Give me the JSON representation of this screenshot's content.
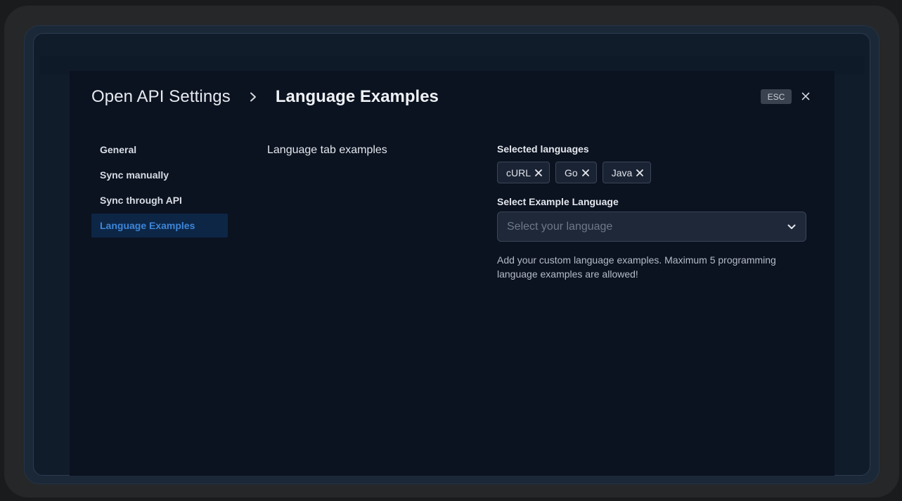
{
  "header": {
    "title": "Open API Settings",
    "subtitle": "Language Examples",
    "esc_label": "ESC"
  },
  "sidebar": {
    "items": [
      {
        "label": "General"
      },
      {
        "label": "Sync manually"
      },
      {
        "label": "Sync through API"
      },
      {
        "label": "Language Examples",
        "active": true
      }
    ]
  },
  "main": {
    "section_title": "Language tab examples",
    "selected_label": "Selected languages",
    "chips": [
      {
        "label": "cURL"
      },
      {
        "label": "Go"
      },
      {
        "label": "Java"
      }
    ],
    "select_label": "Select Example Language",
    "select_placeholder": "Select your language",
    "help_text": "Add your custom language examples. Maximum 5 programming language examples are allowed!"
  },
  "colors": {
    "background": "#0b1220",
    "accent": "#3d86d8",
    "active_bg": "#0d2646"
  },
  "icons": [
    "chevron-right-icon",
    "close-icon",
    "chevron-down-icon"
  ]
}
